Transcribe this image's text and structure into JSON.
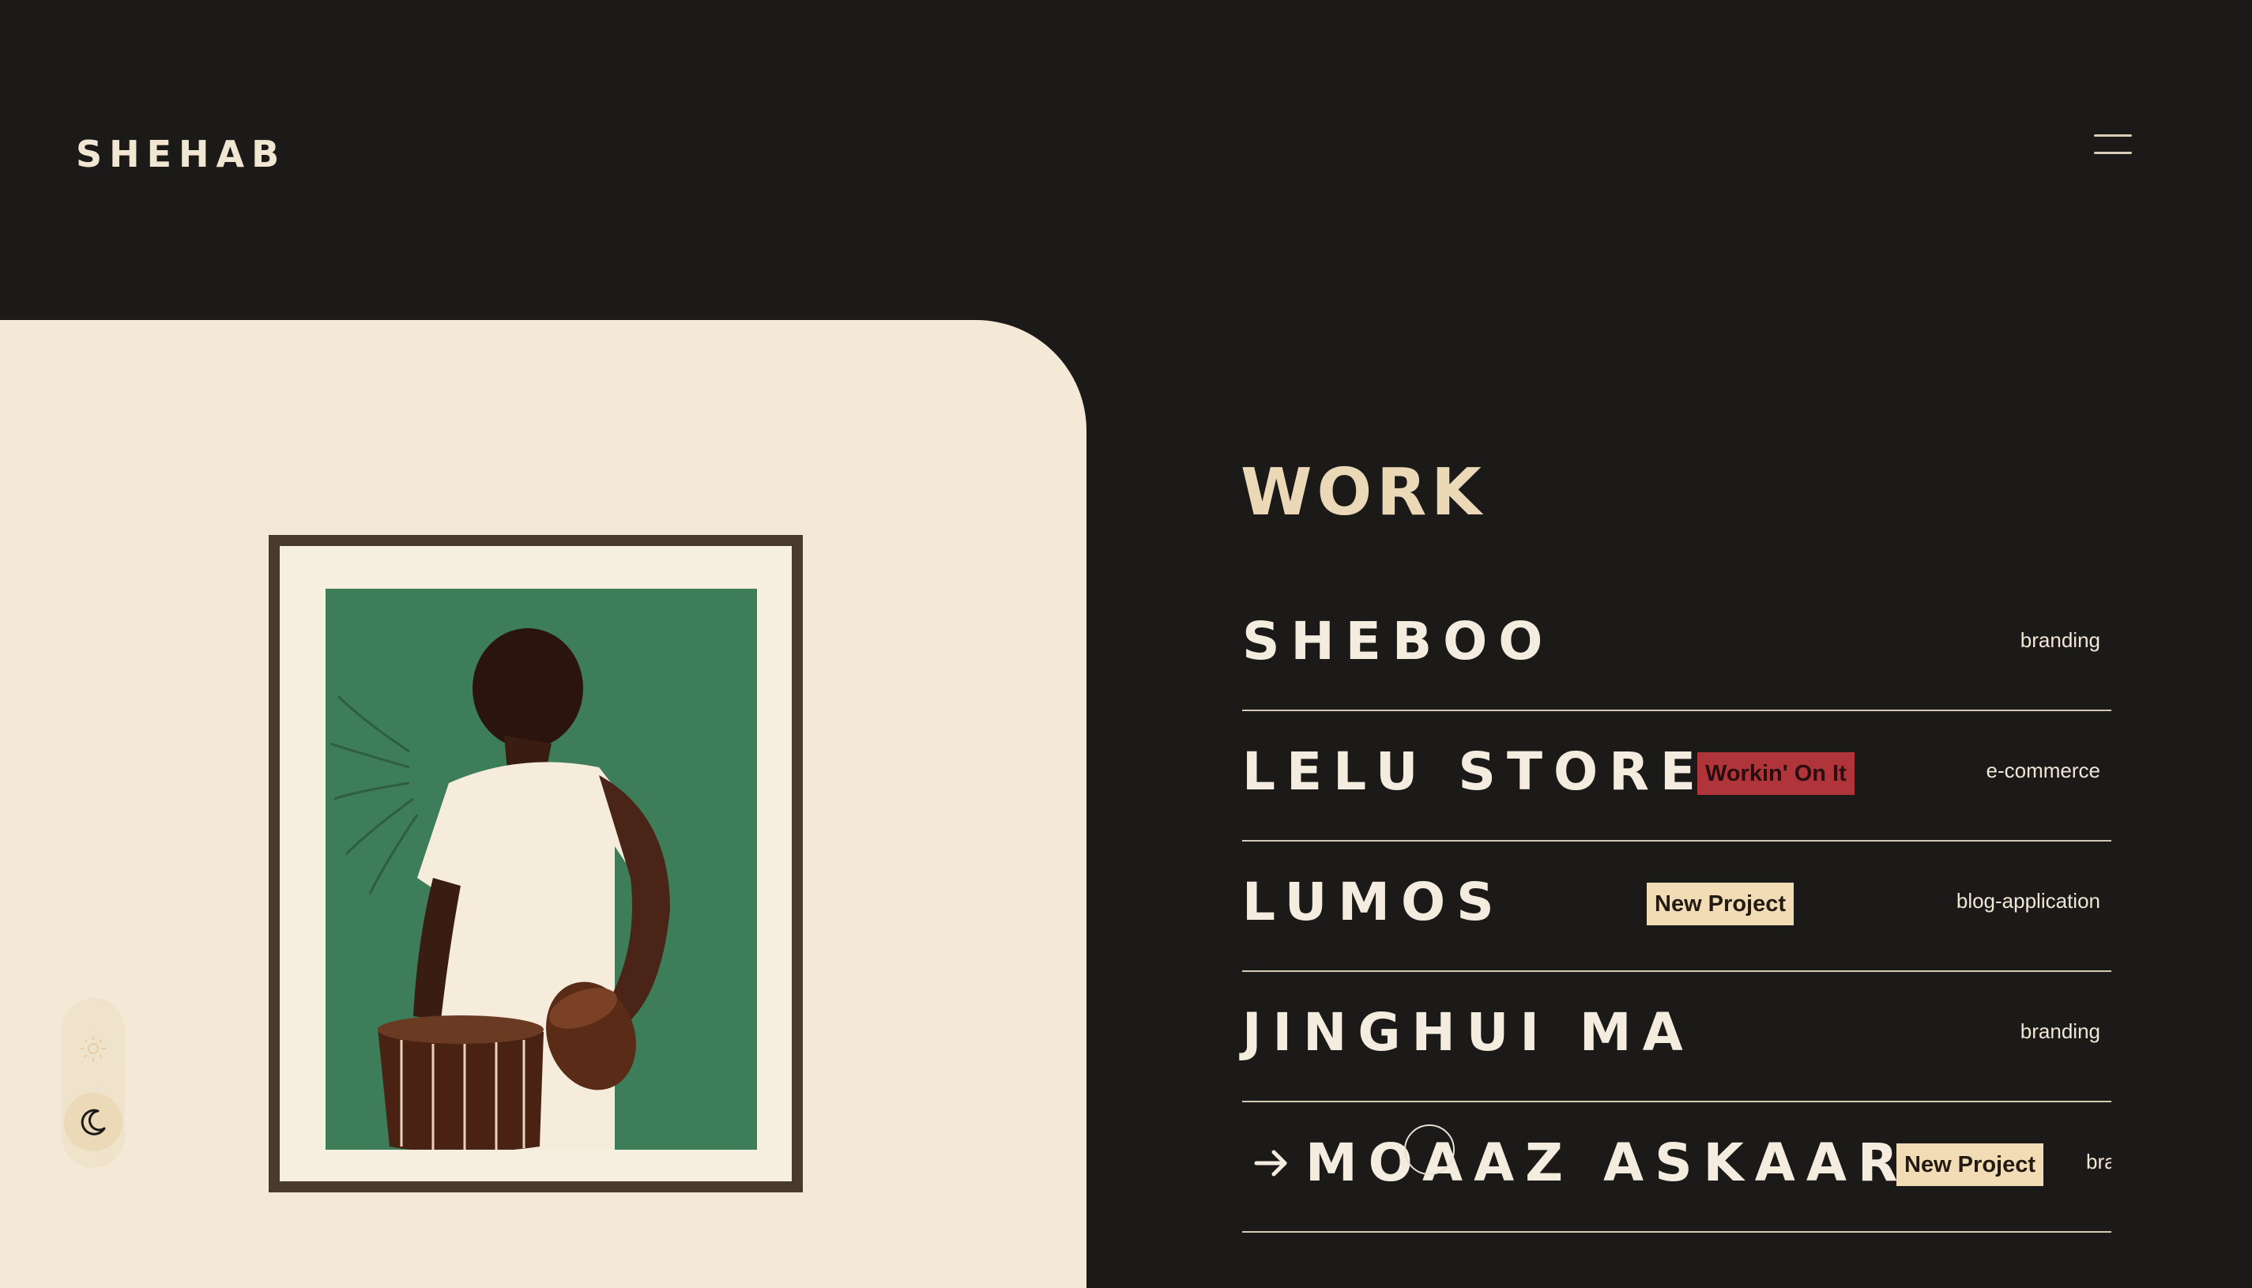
{
  "header": {
    "logo": "SHEHAB"
  },
  "work": {
    "title": "WORK",
    "projects": [
      {
        "name": "SHEBOO",
        "category": "branding",
        "badge": ""
      },
      {
        "name": "LELU STORE",
        "category": "e-commerce",
        "badge": "Workin' On It"
      },
      {
        "name": "LUMOS",
        "category": "blog-application",
        "badge": "New Project"
      },
      {
        "name": "JINGHUI MA",
        "category": "branding",
        "badge": ""
      },
      {
        "name": "MOAAZ ASKAAR",
        "category": "bra",
        "badge": "New Project"
      }
    ]
  },
  "colors": {
    "background": "#1b1a19",
    "panel": "#f3e9d6",
    "accent": "#ead8b7",
    "badge_red": "#b0353a",
    "badge_cream": "#f1dcb6",
    "artwork_green": "#3e7d5a"
  },
  "icons": {
    "menu": "hamburger-icon",
    "theme_light": "sun-icon",
    "theme_dark": "moon-icon",
    "hover_arrow": "arrow-right-icon"
  }
}
